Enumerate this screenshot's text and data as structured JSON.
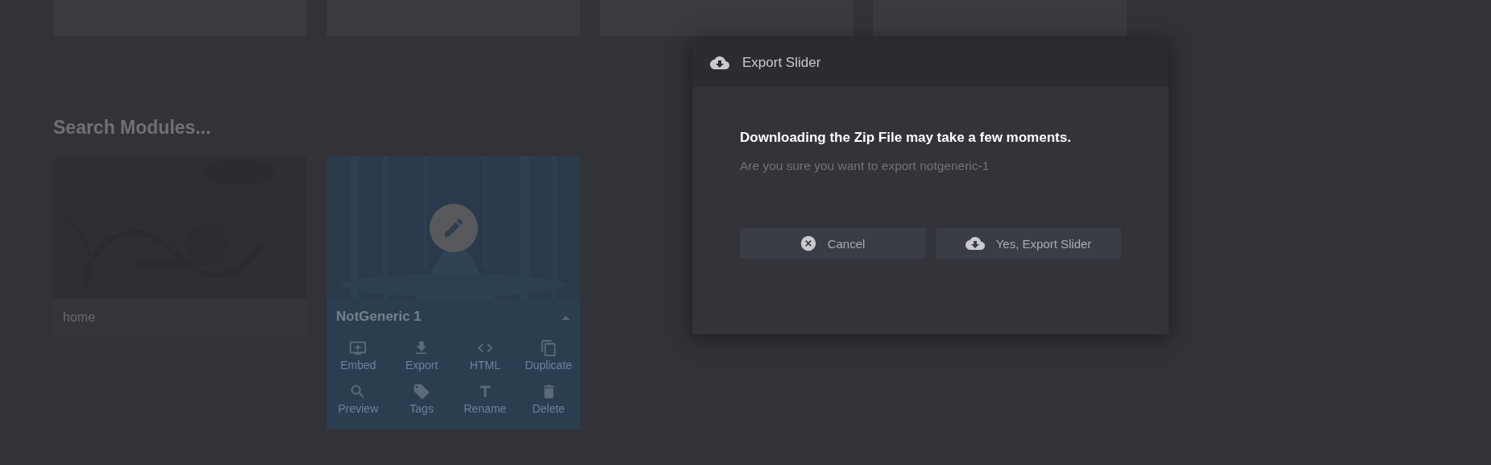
{
  "search": {
    "placeholder": "Search Modules..."
  },
  "modules": [
    {
      "kind": "picture",
      "title": "home",
      "selected": false
    },
    {
      "kind": "picture",
      "title": "NotGeneric 1",
      "selected": true,
      "expanded": true,
      "actions": [
        {
          "kind": "embed",
          "label": "Embed"
        },
        {
          "kind": "export",
          "label": "Export"
        },
        {
          "kind": "html",
          "label": "HTML"
        },
        {
          "kind": "duplicate",
          "label": "Duplicate"
        },
        {
          "kind": "preview",
          "label": "Preview"
        },
        {
          "kind": "tags",
          "label": "Tags"
        },
        {
          "kind": "rename",
          "label": "Rename"
        },
        {
          "kind": "delete",
          "label": "Delete"
        }
      ]
    }
  ],
  "dialog": {
    "title": "Export Slider",
    "heading": "Downloading the Zip File may take a few moments.",
    "message": "Are you sure you want to export notgeneric-1",
    "buttons": [
      {
        "kind": "cancel",
        "label": "Cancel"
      },
      {
        "kind": "export",
        "label": "Yes, Export Slider"
      }
    ]
  }
}
